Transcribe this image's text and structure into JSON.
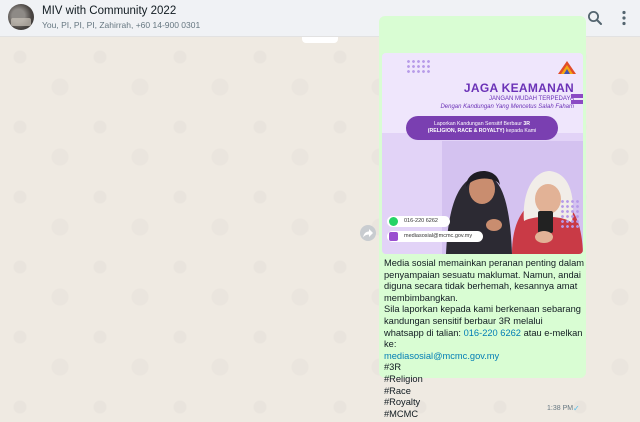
{
  "header": {
    "title": "MIV with Community 2022",
    "subtitle": "You, PI, PI, PI, Zahirrah, +60 14-900 0301"
  },
  "poster": {
    "title": "JAGA KEAMANAN",
    "subtitle1": "JANGAN MUDAH TERPEDAYA",
    "subtitle2": "Dengan Kandungan Yang Mencetus Salah Faham",
    "pill_line1_prefix": "Laporkan Kandungan Sensitif Berbaur ",
    "pill_line1_bold": "3R",
    "pill_line2_bold": "(RELIGION, RACE & ROYALTY)",
    "pill_line2_suffix": " kepada Kami",
    "phone": "016-220 6262",
    "email": "mediasosial@mcmc.gov.my"
  },
  "message": {
    "para1": "Media sosial memainkan peranan penting dalam penyampaian sesuatu maklumat. Namun, andai diguna secara tidak berhemah, kesannya amat membimbangkan.",
    "para2_prefix": "Sila laporkan kepada kami berkenaan sebarang kandungan sensitif berbaur 3R melalui whatsapp di talian: ",
    "phone_link": "016-220 6262",
    "para2_mid": " atau e-melkan ke:",
    "email_link": "mediasosial@mcmc.gov.my",
    "hashtags": [
      "#3R",
      "#Religion",
      "#Race",
      "#Royalty",
      "#MCMC"
    ],
    "time": "1:38 PM",
    "status": "✓"
  },
  "icons": {
    "search": "search-icon",
    "menu": "kebab-menu-icon",
    "forward": "forward-icon"
  },
  "colors": {
    "header_bg": "#f0f2f5",
    "bubble_bg": "#d9fdd3",
    "link": "#027eb5",
    "poster_purple": "#6b32b7"
  }
}
